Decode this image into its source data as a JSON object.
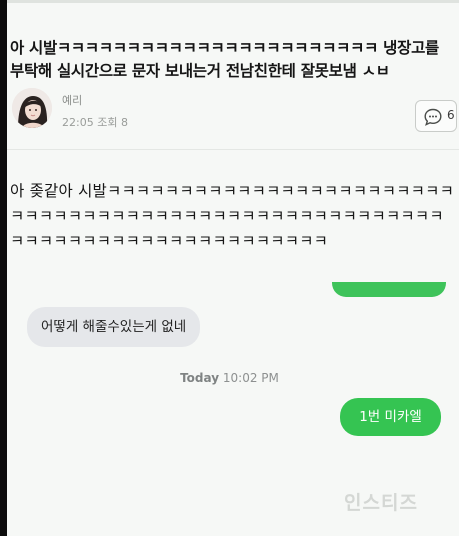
{
  "post": {
    "title": "아 시발ㅋㅋㅋㅋㅋㅋㅋㅋㅋㅋㅋㅋㅋㅋㅋㅋㅋㅋㅋㅋㅋㅋㅋ 냉장고를 부탁해 실시간으로 문자 보내는거 전남친한테 잘못보냄 ㅅㅂ",
    "author": "예리",
    "time": "22:05",
    "views_label": "조회 8",
    "comment_count": "6",
    "body": "아 좆같아 시발ㅋㅋㅋㅋㅋㅋㅋㅋㅋㅋㅋㅋㅋㅋㅋㅋㅋㅋㅋㅋㅋㅋㅋㅋㅋㅋㅋㅋㅋㅋㅋㅋㅋㅋㅋㅋㅋㅋㅋㅋㅋㅋㅋㅋㅋㅋㅋㅋㅋㅋㅋㅋㅋㅋㅋㅋㅋㅋㅋㅋㅋㅋㅋㅋㅋㅋㅋㅋㅋㅋㅋㅋㅋㅋㅋㅋ"
  },
  "chat": {
    "received": "어떻게 해줄수있는게 없네",
    "timestamp_day": "Today",
    "timestamp_time": "10:02 PM",
    "sent": "1번 미카엘"
  },
  "watermark": "인스티즈",
  "colors": {
    "sent_bubble": "#35c452",
    "received_bubble": "#e5e7ea",
    "background": "#f6f8f6"
  },
  "icons": [
    "comment-icon"
  ]
}
